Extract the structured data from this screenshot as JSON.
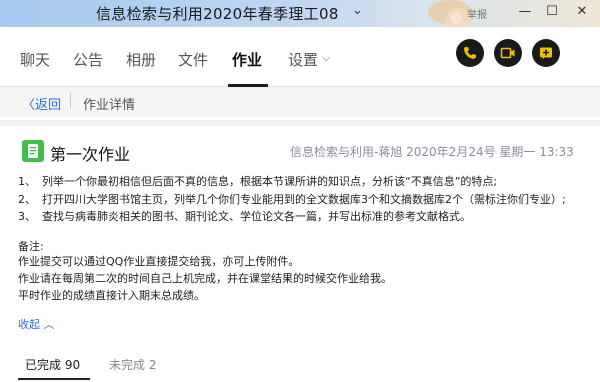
{
  "window": {
    "title": "信息检索与利用2020年春季理工08",
    "report_link": "举报",
    "controls": [
      "minimize-icon",
      "maximize-icon",
      "close-icon"
    ]
  },
  "tabs": [
    {
      "label": "聊天",
      "active": false
    },
    {
      "label": "公告",
      "active": false
    },
    {
      "label": "相册",
      "active": false
    },
    {
      "label": "文件",
      "active": false
    },
    {
      "label": "作业",
      "active": true
    },
    {
      "label": "设置",
      "active": false
    }
  ],
  "toolbar_buttons": [
    "phone-icon",
    "video-call-icon",
    "add-icon"
  ],
  "breadcrumb": {
    "back": "返回",
    "current": "作业详情"
  },
  "homework": {
    "title": "第一次作业",
    "meta": "信息检索与利用-蒋旭 2020年2月24号 星期一 13:33",
    "questions": [
      {
        "num": "1、",
        "text": "列举一个你最初相信但后面不真的信息，根据本节课所讲的知识点，分析该“不真信息”的特点;"
      },
      {
        "num": "2、",
        "text": "打开四川大学图书馆主页，列举几个你们专业能用到的全文数据库3个和文摘数据库2个（需标注你们专业）;"
      },
      {
        "num": "3、",
        "text": "查找与病毒肺炎相关的图书、期刊论文、学位论文各一篇，并写出标准的参考文献格式。"
      }
    ],
    "notes": [
      "备注:",
      "作业提交可以通过QQ作业直接提交给我，亦可上传附件。",
      "作业请在每周第二次的时间自己上机完成，并在课堂结果的时候交作业给我。",
      "平时作业的成绩直接计入期末总成绩。"
    ],
    "collapse": "收起"
  },
  "status_tabs": {
    "done": "已完成 90",
    "undone": "未完成 2"
  },
  "colors": {
    "accent_blue": "#2b6fd6",
    "icon_green": "#3fbf4a",
    "meta_grey": "#8b8ba4"
  }
}
